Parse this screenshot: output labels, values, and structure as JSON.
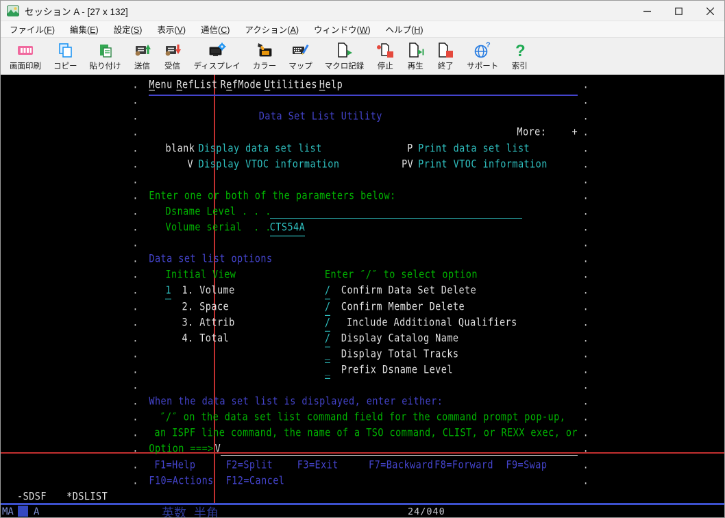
{
  "window": {
    "title": "セッション A - [27 x 132]",
    "controls": [
      "minimize",
      "maximize",
      "close"
    ]
  },
  "menubar": {
    "items": [
      {
        "name": "file",
        "label": "ファイル(F)"
      },
      {
        "name": "edit",
        "label": "編集(E)"
      },
      {
        "name": "settings",
        "label": "設定(S)"
      },
      {
        "name": "view",
        "label": "表示(V)"
      },
      {
        "name": "communication",
        "label": "通信(C)"
      },
      {
        "name": "actions",
        "label": "アクション(A)"
      },
      {
        "name": "window",
        "label": "ウィンドウ(W)"
      },
      {
        "name": "help",
        "label": "ヘルプ(H)"
      }
    ]
  },
  "toolbar": {
    "items": [
      {
        "name": "print-screen",
        "icon": "print-icon",
        "label": "画面印刷"
      },
      {
        "name": "copy",
        "icon": "copy-icon",
        "label": "コピー"
      },
      {
        "name": "paste",
        "icon": "paste-icon",
        "label": "貼り付け"
      },
      {
        "name": "send",
        "icon": "send-icon",
        "label": "送信"
      },
      {
        "name": "receive",
        "icon": "receive-icon",
        "label": "受信"
      },
      {
        "name": "display",
        "icon": "display-icon",
        "label": "ディスプレイ"
      },
      {
        "name": "color",
        "icon": "color-icon",
        "label": "カラー"
      },
      {
        "name": "map",
        "icon": "map-icon",
        "label": "マップ"
      },
      {
        "name": "macro-record",
        "icon": "macro-record-icon",
        "label": "マクロ記録"
      },
      {
        "name": "stop",
        "icon": "stop-icon",
        "label": "停止"
      },
      {
        "name": "play",
        "icon": "play-icon",
        "label": "再生"
      },
      {
        "name": "exit",
        "icon": "exit-icon",
        "label": "終了"
      },
      {
        "name": "support",
        "icon": "support-icon",
        "label": "サポート"
      },
      {
        "name": "index",
        "icon": "index-icon",
        "label": "索引"
      }
    ]
  },
  "terminal": {
    "screen_size": "27 x 132",
    "palette": {
      "green": "#00b400",
      "white": "#e2e2e2",
      "blue": "#4444cc",
      "teal": "#2fc0c0",
      "dots": "#cfcfcf",
      "ruler": "#c23030",
      "background": "#000000"
    },
    "dots": {
      "char": ".",
      "left_col": 24,
      "right_col": 106,
      "row_start": 1,
      "row_end": 26
    },
    "separator": {
      "row": 2,
      "col": 27,
      "cols": 78
    },
    "rows": [
      {
        "r": 1,
        "spans": [
          {
            "c": 27,
            "t": "Menu",
            "k": "w",
            "m": 0,
            "name": "actionbar-menu",
            "i": true
          },
          {
            "c": 32,
            "t": "RefList",
            "k": "w",
            "m": 0,
            "name": "actionbar-reflist",
            "i": true
          },
          {
            "c": 40,
            "t": "RefMode",
            "k": "w",
            "m": 1,
            "name": "actionbar-refmode",
            "i": true
          },
          {
            "c": 48,
            "t": "Utilities",
            "k": "w",
            "m": 0,
            "name": "actionbar-utilities",
            "i": true
          },
          {
            "c": 58,
            "t": "Help",
            "k": "w",
            "m": 0,
            "name": "actionbar-help",
            "i": true
          }
        ]
      },
      {
        "r": 3,
        "spans": [
          {
            "c": 47,
            "t": "Data Set List Utility",
            "k": "b",
            "name": "panel-title"
          }
        ]
      },
      {
        "r": 4,
        "spans": [
          {
            "c": 94,
            "t": "More:",
            "k": "w",
            "name": "more-indicator"
          },
          {
            "c": 104,
            "t": "+",
            "k": "w",
            "name": "more-plus"
          }
        ]
      },
      {
        "r": 5,
        "spans": [
          {
            "c": 30,
            "t": "blank",
            "k": "w"
          },
          {
            "c": 36,
            "t": "Display data set list",
            "k": "t"
          },
          {
            "c": 74,
            "t": "P",
            "k": "w"
          },
          {
            "c": 76,
            "t": "Print data set list",
            "k": "t"
          }
        ]
      },
      {
        "r": 6,
        "spans": [
          {
            "c": 34,
            "t": "V",
            "k": "w"
          },
          {
            "c": 36,
            "t": "Display VTOC information",
            "k": "t"
          },
          {
            "c": 73,
            "t": "PV",
            "k": "w"
          },
          {
            "c": 76,
            "t": "Print VTOC information",
            "k": "t"
          }
        ]
      },
      {
        "r": 8,
        "spans": [
          {
            "c": 27,
            "t": "Enter one or both of the parameters below:",
            "k": "g"
          }
        ]
      },
      {
        "r": 9,
        "spans": [
          {
            "c": 30,
            "t": "Dsname Level . . .",
            "k": "g"
          },
          {
            "c": 49,
            "rule": 46,
            "k": "t",
            "name": "dsname-level-field",
            "i": true
          }
        ]
      },
      {
        "r": 10,
        "spans": [
          {
            "c": 30,
            "t": "Volume serial  . .",
            "k": "g"
          },
          {
            "c": 49,
            "t": "CTS54A",
            "k": "t",
            "u": true,
            "name": "volume-serial-field",
            "i": true
          }
        ]
      },
      {
        "r": 12,
        "spans": [
          {
            "c": 27,
            "t": "Data set list options",
            "k": "b"
          }
        ]
      },
      {
        "r": 13,
        "spans": [
          {
            "c": 30,
            "t": "Initial View",
            "k": "g"
          },
          {
            "c": 59,
            "t": "Enter ″/″ to select option",
            "k": "g"
          }
        ]
      },
      {
        "r": 14,
        "spans": [
          {
            "c": 30,
            "t": "1",
            "k": "t",
            "u": true,
            "name": "initial-view-field",
            "i": true
          },
          {
            "c": 33,
            "t": "1. Volume",
            "k": "w"
          },
          {
            "c": 59,
            "t": "/",
            "k": "t",
            "u": true,
            "name": "field-confirm-data-set-delete",
            "i": true
          },
          {
            "c": 62,
            "t": "Confirm Data Set Delete",
            "k": "w"
          }
        ]
      },
      {
        "r": 15,
        "spans": [
          {
            "c": 33,
            "t": "2. Space",
            "k": "w"
          },
          {
            "c": 59,
            "t": "/",
            "k": "t",
            "u": true,
            "name": "field-confirm-member-delete",
            "i": true
          },
          {
            "c": 62,
            "t": "Confirm Member Delete",
            "k": "w"
          }
        ]
      },
      {
        "r": 16,
        "spans": [
          {
            "c": 33,
            "t": "3. Attrib",
            "k": "w"
          },
          {
            "c": 59,
            "t": "/",
            "k": "t",
            "u": true,
            "name": "field-include-additional-qualifiers",
            "i": true
          },
          {
            "c": 63,
            "t": "Include Additional Qualifiers",
            "k": "w"
          }
        ]
      },
      {
        "r": 17,
        "spans": [
          {
            "c": 33,
            "t": "4. Total",
            "k": "w"
          },
          {
            "c": 59,
            "t": "/",
            "k": "t",
            "u": true,
            "name": "field-display-catalog-name",
            "i": true
          },
          {
            "c": 62,
            "t": "Display Catalog Name",
            "k": "w"
          }
        ]
      },
      {
        "r": 18,
        "spans": [
          {
            "c": 59,
            "t": "_",
            "k": "t",
            "u": true,
            "name": "field-display-total-tracks",
            "i": true
          },
          {
            "c": 62,
            "t": "Display Total Tracks",
            "k": "w"
          }
        ]
      },
      {
        "r": 19,
        "spans": [
          {
            "c": 59,
            "t": "_",
            "k": "t",
            "u": true,
            "name": "field-prefix-dsname-level",
            "i": true
          },
          {
            "c": 62,
            "t": "Prefix Dsname Level",
            "k": "w"
          }
        ]
      },
      {
        "r": 21,
        "spans": [
          {
            "c": 27,
            "t": "When the data set list is displayed, enter either:",
            "k": "b"
          }
        ]
      },
      {
        "r": 22,
        "spans": [
          {
            "c": 29,
            "t": "″/″ on the data set list command field for the command prompt pop-up,",
            "k": "g"
          }
        ]
      },
      {
        "r": 23,
        "spans": [
          {
            "c": 28,
            "t": "an ISPF line command, the name of a TSO command, CLIST, or REXX exec, or",
            "k": "g"
          }
        ]
      },
      {
        "r": 24,
        "spans": [
          {
            "c": 27,
            "t": "Option ===>",
            "k": "g",
            "name": "option-prompt"
          },
          {
            "c": 39,
            "t": "V",
            "k": "w",
            "name": "option-command-value",
            "i": true
          },
          {
            "c": 40,
            "rule": 65,
            "k": "wd",
            "name": "option-command-field",
            "i": true
          }
        ]
      },
      {
        "r": 25,
        "spans": [
          {
            "c": 28,
            "t": "F1=Help",
            "k": "b"
          },
          {
            "c": 41,
            "t": "F2=Split",
            "k": "b"
          },
          {
            "c": 54,
            "t": "F3=Exit",
            "k": "b"
          },
          {
            "c": 67,
            "t": "F7=Backward",
            "k": "b"
          },
          {
            "c": 79,
            "t": "F8=Forward",
            "k": "b"
          },
          {
            "c": 92,
            "t": "F9=Swap",
            "k": "b"
          }
        ]
      },
      {
        "r": 26,
        "spans": [
          {
            "c": 27,
            "t": "F10=Actions",
            "k": "b"
          },
          {
            "c": 41,
            "t": "F12=Cancel",
            "k": "b"
          }
        ]
      },
      {
        "r": 27,
        "spans": [
          {
            "c": 3,
            "t": "-SDSF",
            "k": "w",
            "name": "task-sdsf",
            "i": true
          },
          {
            "c": 12,
            "t": "*DSLIST",
            "k": "w",
            "name": "task-dslist",
            "i": true
          }
        ]
      }
    ]
  },
  "oia": {
    "left": "MA",
    "short": "A",
    "ime_status": "英数 半角",
    "cursor_position": "24/040"
  }
}
